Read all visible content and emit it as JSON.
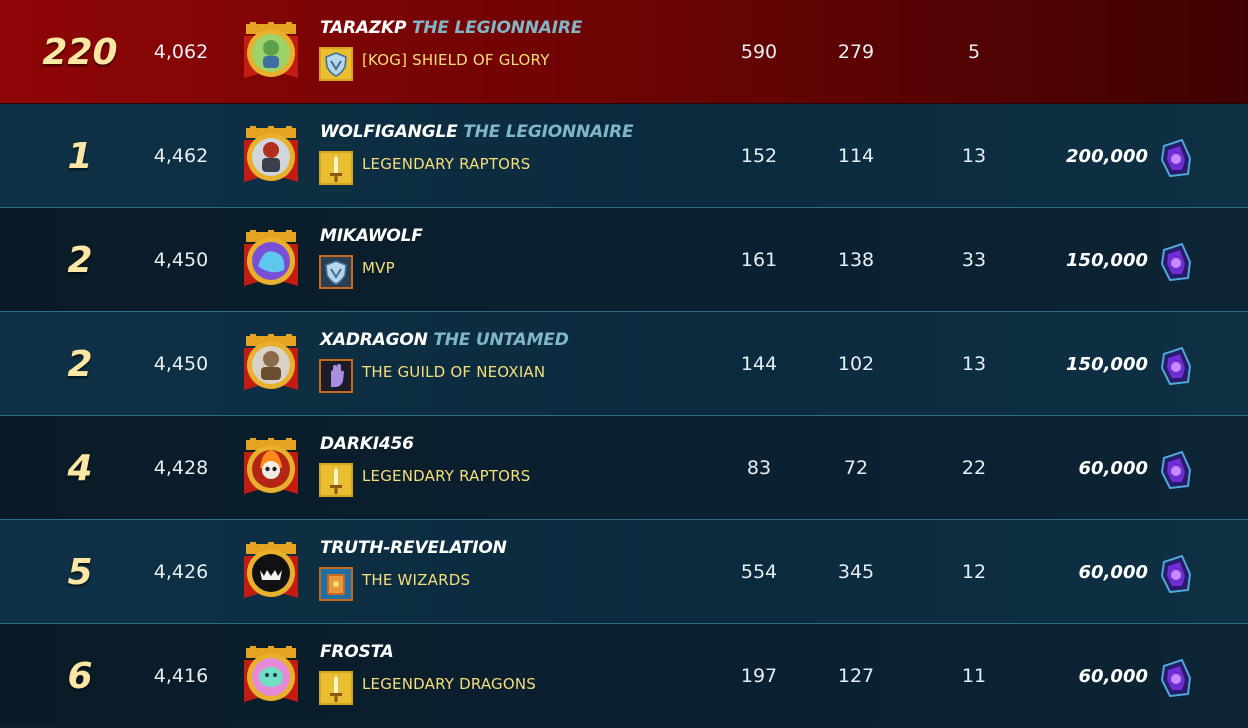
{
  "leaderboard": {
    "rows": [
      {
        "rank": "220",
        "rating": "4,062",
        "player": "TARAZKP",
        "title": "THE LEGIONNAIRE",
        "guild": "[KOG] SHIELD OF GLORY",
        "stat1": "590",
        "stat2": "279",
        "stat3": "5",
        "reward": "",
        "avatar_icon": "green-goblin-avatar-icon",
        "guild_icon": "blue-shield-guild-icon",
        "highlight": true
      },
      {
        "rank": "1",
        "rating": "4,462",
        "player": "WOLFIGANGLE",
        "title": "THE LEGIONNAIRE",
        "guild": "LEGENDARY RAPTORS",
        "stat1": "152",
        "stat2": "114",
        "stat3": "13",
        "reward": "200,000",
        "avatar_icon": "red-knight-avatar-icon",
        "guild_icon": "gold-sword-guild-icon"
      },
      {
        "rank": "2",
        "rating": "4,450",
        "player": "MIKAWOLF",
        "title": "",
        "guild": "MVP",
        "stat1": "161",
        "stat2": "138",
        "stat3": "33",
        "reward": "150,000",
        "avatar_icon": "blue-dragon-avatar-icon",
        "guild_icon": "blue-shield-guild-icon"
      },
      {
        "rank": "2",
        "rating": "4,450",
        "player": "XADRAGON",
        "title": "THE UNTAMED",
        "guild": "THE GUILD OF NEOXIAN",
        "stat1": "144",
        "stat2": "102",
        "stat3": "13",
        "reward": "150,000",
        "avatar_icon": "armored-warrior-avatar-icon",
        "guild_icon": "purple-hand-guild-icon"
      },
      {
        "rank": "4",
        "rating": "4,428",
        "player": "DARKI456",
        "title": "",
        "guild": "LEGENDARY RAPTORS",
        "stat1": "83",
        "stat2": "72",
        "stat3": "22",
        "reward": "60,000",
        "avatar_icon": "fire-skull-avatar-icon",
        "guild_icon": "gold-sword-guild-icon"
      },
      {
        "rank": "5",
        "rating": "4,426",
        "player": "TRUTH-REVELATION",
        "title": "",
        "guild": "THE WIZARDS",
        "stat1": "554",
        "stat2": "345",
        "stat3": "12",
        "reward": "60,000",
        "avatar_icon": "black-monster-avatar-icon",
        "guild_icon": "spellbook-guild-icon"
      },
      {
        "rank": "6",
        "rating": "4,416",
        "player": "FROSTA",
        "title": "",
        "guild": "LEGENDARY DRAGONS",
        "stat1": "197",
        "stat2": "127",
        "stat3": "11",
        "reward": "60,000",
        "avatar_icon": "teal-creature-avatar-icon",
        "guild_icon": "gold-sword-guild-icon"
      }
    ]
  },
  "colors": {
    "highlight_row": "#8f0606",
    "rank_text": "#fbe7a3",
    "guild_text": "#f6df7c",
    "title_text": "#7fb6c8",
    "divider": "#2f6d86"
  },
  "reward_icon": "purple-crystal-gem-icon"
}
